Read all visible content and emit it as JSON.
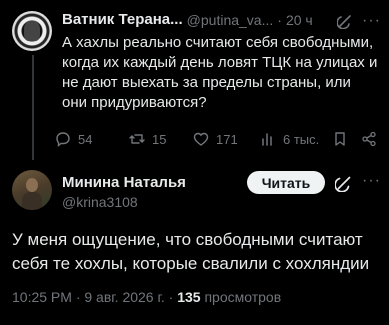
{
  "parent": {
    "name": "Ватник Терана...",
    "handle": "@putina_va...",
    "sep": "·",
    "time": "20 ч",
    "text": "А хахлы реально считают себя свободными, когда их каждый день ловят ТЦК на улицах и не дают выехать за пределы страны, или они придуриваются?",
    "actions": {
      "replies": "54",
      "reposts": "15",
      "likes": "171",
      "views": "6 тыс."
    }
  },
  "main": {
    "name": "Минина Наталья",
    "handle": "@krina3108",
    "follow_label": "Читать",
    "text": "У меня ощущение, что свободными считают себя те хохлы, которые свалили с хохляндии",
    "timestamp": "10:25 PM · 9 авг. 2026 г. ·",
    "views_count": "135",
    "views_label": "просмотров"
  },
  "colors": {
    "background": "#000000",
    "text": "#e7e9ea",
    "muted": "#71767b",
    "button_bg": "#eff3f4"
  }
}
